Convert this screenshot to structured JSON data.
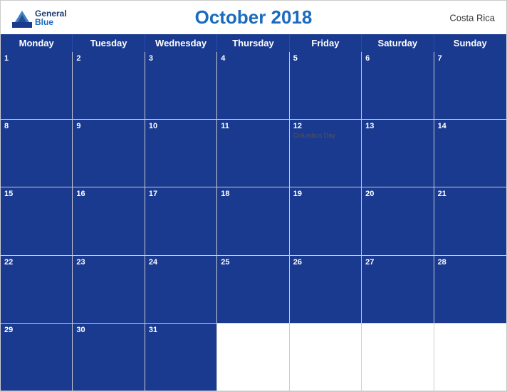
{
  "header": {
    "title": "October 2018",
    "country": "Costa Rica",
    "logo_general": "General",
    "logo_blue": "Blue"
  },
  "days_of_week": [
    {
      "label": "Monday"
    },
    {
      "label": "Tuesday"
    },
    {
      "label": "Wednesday"
    },
    {
      "label": "Thursday"
    },
    {
      "label": "Friday"
    },
    {
      "label": "Saturday"
    },
    {
      "label": "Sunday"
    }
  ],
  "weeks": [
    {
      "days": [
        {
          "num": "1",
          "blue": true,
          "event": ""
        },
        {
          "num": "2",
          "blue": true,
          "event": ""
        },
        {
          "num": "3",
          "blue": true,
          "event": ""
        },
        {
          "num": "4",
          "blue": true,
          "event": ""
        },
        {
          "num": "5",
          "blue": true,
          "event": ""
        },
        {
          "num": "6",
          "blue": true,
          "event": ""
        },
        {
          "num": "7",
          "blue": true,
          "event": ""
        }
      ]
    },
    {
      "days": [
        {
          "num": "8",
          "blue": true,
          "event": ""
        },
        {
          "num": "9",
          "blue": true,
          "event": ""
        },
        {
          "num": "10",
          "blue": true,
          "event": ""
        },
        {
          "num": "11",
          "blue": true,
          "event": ""
        },
        {
          "num": "12",
          "blue": true,
          "event": "Columbus Day"
        },
        {
          "num": "13",
          "blue": true,
          "event": ""
        },
        {
          "num": "14",
          "blue": true,
          "event": ""
        }
      ]
    },
    {
      "days": [
        {
          "num": "15",
          "blue": true,
          "event": ""
        },
        {
          "num": "16",
          "blue": true,
          "event": ""
        },
        {
          "num": "17",
          "blue": true,
          "event": ""
        },
        {
          "num": "18",
          "blue": true,
          "event": ""
        },
        {
          "num": "19",
          "blue": true,
          "event": ""
        },
        {
          "num": "20",
          "blue": true,
          "event": ""
        },
        {
          "num": "21",
          "blue": true,
          "event": ""
        }
      ]
    },
    {
      "days": [
        {
          "num": "22",
          "blue": true,
          "event": ""
        },
        {
          "num": "23",
          "blue": true,
          "event": ""
        },
        {
          "num": "24",
          "blue": true,
          "event": ""
        },
        {
          "num": "25",
          "blue": true,
          "event": ""
        },
        {
          "num": "26",
          "blue": true,
          "event": ""
        },
        {
          "num": "27",
          "blue": true,
          "event": ""
        },
        {
          "num": "28",
          "blue": true,
          "event": ""
        }
      ]
    },
    {
      "days": [
        {
          "num": "29",
          "blue": true,
          "event": ""
        },
        {
          "num": "30",
          "blue": true,
          "event": ""
        },
        {
          "num": "31",
          "blue": true,
          "event": ""
        },
        {
          "num": "",
          "blue": false,
          "event": ""
        },
        {
          "num": "",
          "blue": false,
          "event": ""
        },
        {
          "num": "",
          "blue": false,
          "event": ""
        },
        {
          "num": "",
          "blue": false,
          "event": ""
        }
      ]
    }
  ],
  "colors": {
    "header_bg": "#1a3a8f",
    "accent_blue": "#1a6bbf",
    "dark_blue": "#1a3a6b"
  }
}
